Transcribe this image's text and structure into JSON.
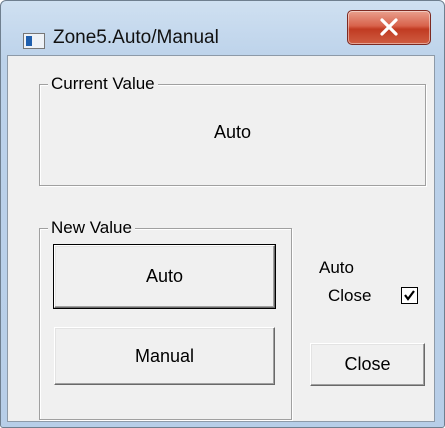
{
  "window": {
    "title": "Zone5.Auto/Manual",
    "close_glyph": "X",
    "icon": "app-window-icon"
  },
  "current_value_group": {
    "legend": "Current Value",
    "value": "Auto"
  },
  "new_value_group": {
    "legend": "New Value",
    "auto_button": "Auto",
    "manual_button": "Manual"
  },
  "auto_close": {
    "label_line1": "Auto",
    "label_line2": "Close",
    "checked": true
  },
  "close_button": "Close",
  "colors": {
    "close_button_red": "#c13b22",
    "window_frame": "#bcd2ea",
    "dialog_face": "#f0f0f0"
  }
}
